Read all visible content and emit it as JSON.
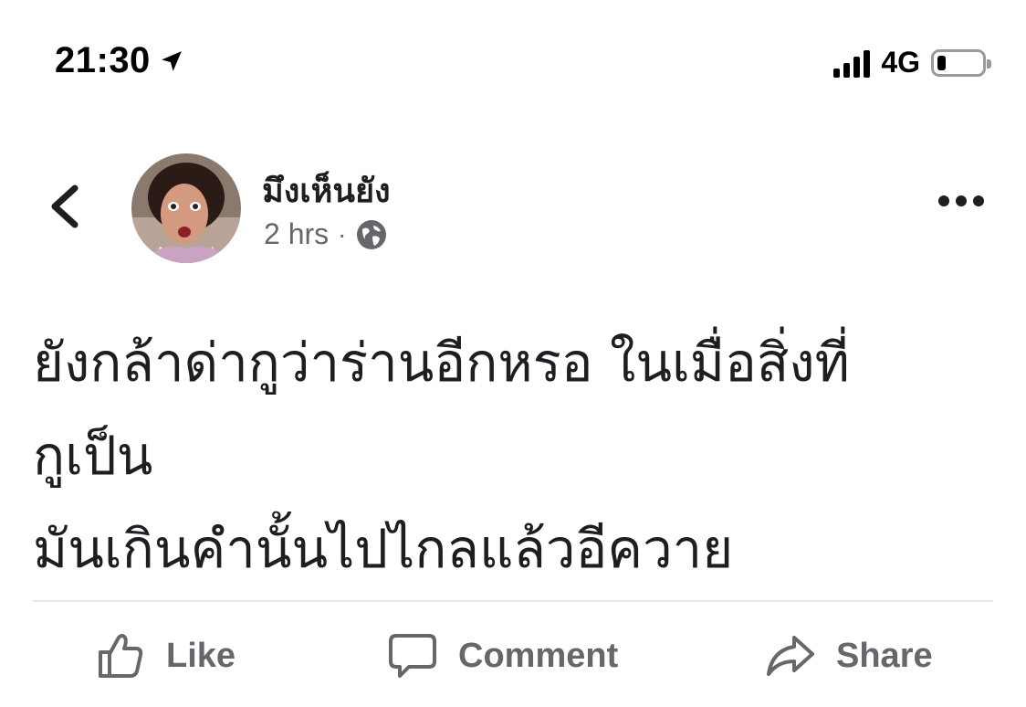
{
  "status_bar": {
    "time": "21:30",
    "network": "4G",
    "battery_level": 0.2
  },
  "post": {
    "author": "มึงเห็นยัง",
    "time_ago": "2 hrs",
    "separator": "·",
    "audience_icon": "globe-icon",
    "text_lines": [
      "ยังกล้าด่ากูว่าร่านอีกหรอ ในเมื่อสิ่งที่",
      "กูเป็น",
      "มันเกินคำนั้นไปไกลแล้วอีควาย"
    ]
  },
  "actions": {
    "like_label": "Like",
    "comment_label": "Comment",
    "share_label": "Share"
  },
  "colors": {
    "text_primary": "#1c1e21",
    "text_secondary": "#65676b",
    "divider": "#e4e6eb"
  }
}
